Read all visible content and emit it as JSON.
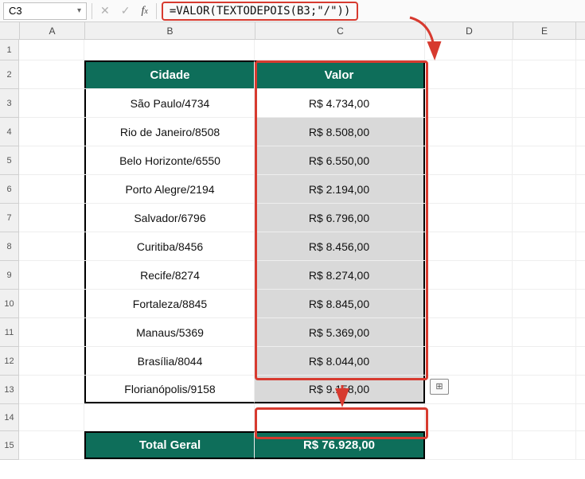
{
  "nameBox": "C3",
  "formula": "=VALOR(TEXTODEPOIS(B3;\"/\"))",
  "columns": [
    "A",
    "B",
    "C",
    "D",
    "E"
  ],
  "rowNumbers": [
    "1",
    "2",
    "3",
    "4",
    "5",
    "6",
    "7",
    "8",
    "9",
    "10",
    "11",
    "12",
    "13",
    "14",
    "15"
  ],
  "header": {
    "b": "Cidade",
    "c": "Valor"
  },
  "rows": [
    {
      "b": "São Paulo/4734",
      "c": "R$ 4.734,00"
    },
    {
      "b": "Rio de Janeiro/8508",
      "c": "R$ 8.508,00"
    },
    {
      "b": "Belo Horizonte/6550",
      "c": "R$ 6.550,00"
    },
    {
      "b": "Porto Alegre/2194",
      "c": "R$ 2.194,00"
    },
    {
      "b": "Salvador/6796",
      "c": "R$ 6.796,00"
    },
    {
      "b": "Curitiba/8456",
      "c": "R$ 8.456,00"
    },
    {
      "b": "Recife/8274",
      "c": "R$ 8.274,00"
    },
    {
      "b": "Fortaleza/8845",
      "c": "R$ 8.845,00"
    },
    {
      "b": "Manaus/5369",
      "c": "R$ 5.369,00"
    },
    {
      "b": "Brasília/8044",
      "c": "R$ 8.044,00"
    },
    {
      "b": "Florianópolis/9158",
      "c": "R$ 9.158,00"
    }
  ],
  "total": {
    "label": "Total Geral",
    "value": "R$ 76.928,00"
  },
  "autofillHint": "⊞"
}
